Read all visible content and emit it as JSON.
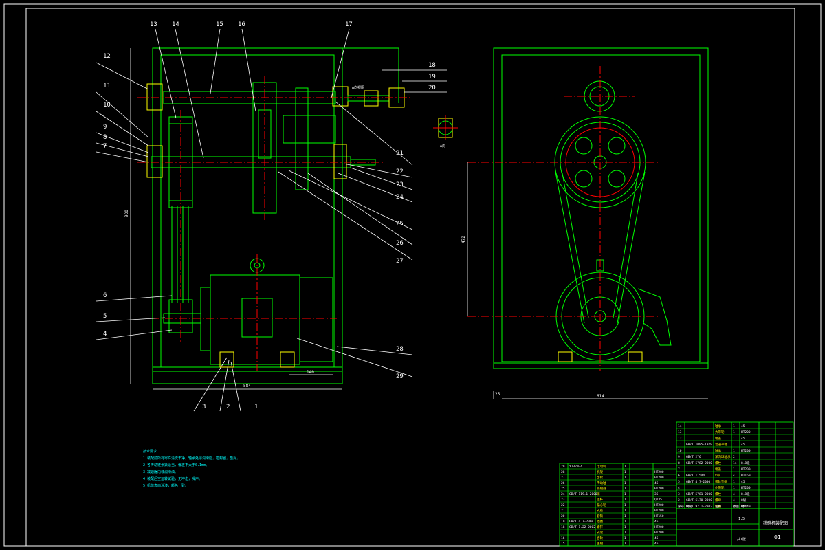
{
  "drawing": {
    "colors": {
      "background": "#000000",
      "frame": "#ffffff",
      "outline": "#00ff00",
      "hidden": "#ffff00",
      "center_line": "#ff0000",
      "labels": "#ffffff",
      "title_block": "#00ff00",
      "notes": "#00ffff"
    },
    "callouts_left": [
      "12",
      "11",
      "10",
      "9",
      "8",
      "7",
      "6",
      "5",
      "4"
    ],
    "callouts_top": [
      "13",
      "14",
      "15",
      "16",
      "17",
      "18",
      "19",
      "20"
    ],
    "callouts_right": [
      "21",
      "22",
      "23",
      "24",
      "25",
      "26",
      "27",
      "28",
      "29"
    ],
    "callouts_bottom": [
      "3",
      "2",
      "1"
    ],
    "dimensions": {
      "left_height": "930",
      "left_width": "584",
      "bearing_offset": "140",
      "side_center_height": "472",
      "side_width": "614",
      "side_foot": "25"
    },
    "section_label": "A向视图",
    "detail_label": "A向",
    "tech_notes": [
      "技术要求",
      "1.装配前所有零件清洗干净，轴承处涂润滑脂，密封圈，垫片，...",
      "2.各传动链张紧适当，偏差不大于0.1mm。",
      "3.减速器内装润滑油。",
      "4.装配后空运转试验，无冲击，噪声。",
      "5.机体表面涂漆，颜色一致。"
    ],
    "bom_right": [
      [
        "14",
        "",
        "轴承",
        "1",
        "45"
      ],
      [
        "13",
        "",
        "大带轮",
        "1",
        "HT200"
      ],
      [
        "12",
        "",
        "端盖",
        "1",
        "45"
      ],
      [
        "11",
        "GB/T 1095-1979",
        "普通平键",
        "1",
        "45"
      ],
      [
        "10",
        "",
        "轴承",
        "1",
        "HT200"
      ],
      [
        "9",
        "GB/T 276",
        "深沟球轴承",
        "2",
        ""
      ],
      [
        "8",
        "GB/T 5782-2000",
        "螺栓",
        "14",
        "8.8级"
      ],
      [
        "7",
        "",
        "端盖",
        "1",
        "HT200"
      ],
      [
        "6",
        "GB/T 11544",
        "V带",
        "4",
        "HT150"
      ],
      [
        "5",
        "GB/T 4.7-2000",
        "带轮垫圈",
        "1",
        "45"
      ],
      [
        "4",
        "",
        "小带轮",
        "1",
        "HT200"
      ],
      [
        "3",
        "GB/T 5781-2000",
        "螺栓",
        "4",
        "8.8级"
      ],
      [
        "2",
        "GB/T 6170-2000",
        "螺母",
        "4",
        "8级"
      ],
      [
        "1",
        "GB/T 97.1-2002",
        "垫圈",
        "4",
        "HV140"
      ]
    ],
    "bom_left": [
      [
        "29",
        "Y132M-4",
        "电动机",
        "1",
        ""
      ],
      [
        "28",
        "",
        "机架",
        "1",
        "HT200"
      ],
      [
        "27",
        "",
        "齿轮",
        "1",
        "HT200"
      ],
      [
        "26",
        "",
        "传动轴",
        "1",
        "45"
      ],
      [
        "25",
        "",
        "联轴器",
        "1",
        "HT200"
      ],
      [
        "24",
        "GB/T 119.1-2000",
        "销",
        "1",
        "35"
      ],
      [
        "23",
        "",
        "连杆",
        "1",
        "Q235"
      ],
      [
        "22",
        "",
        "偏心轮",
        "1",
        "HT200"
      ],
      [
        "21",
        "",
        "支座",
        "1",
        "HT200"
      ],
      [
        "20",
        "",
        "套筒",
        "1",
        "HT150"
      ],
      [
        "19",
        "GB/T 4.7-2000",
        "挡圈",
        "1",
        "45"
      ],
      [
        "18",
        "GB/T 1.22-2002",
        "螺钉",
        "1",
        "HT200"
      ],
      [
        "17",
        "",
        "支架",
        "1",
        "HT200"
      ],
      [
        "16",
        "",
        "齿轮",
        "1",
        "45"
      ],
      [
        "15",
        "",
        "主轴",
        "1",
        "45"
      ]
    ],
    "bom_header": [
      "序号",
      "代号",
      "名称",
      "数量",
      "材料"
    ],
    "title": "粉碎机装配图",
    "drawing_no": "01",
    "scale": "1:5",
    "sheet": "共1张"
  }
}
